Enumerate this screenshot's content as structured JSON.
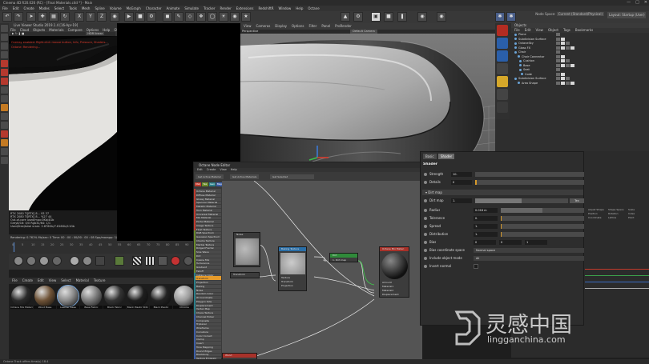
{
  "app": {
    "title": "Cinema 4D R20.026 (RC) - [Final Materials.c4d *] - Main",
    "menus": [
      "File",
      "Edit",
      "Create",
      "Modes",
      "Select",
      "Tools",
      "Mesh",
      "Spline",
      "Volume",
      "MoGraph",
      "Character",
      "Animate",
      "Simulate",
      "Tracker",
      "Render",
      "Extensions",
      "RedshiftR",
      "Window",
      "Help",
      "Octane"
    ],
    "node_space_label": "Node Space:",
    "node_space_value": "Current (Standard/Physical)",
    "layout_label": "Layout:",
    "layout_value": "Startup (User)"
  },
  "toolbar": {
    "x": "X",
    "y": "Y",
    "z": "Z"
  },
  "live_viewer": {
    "title": "Live Viewer Studio 2019.1.4 [16-Apr-19]",
    "menus": [
      "File",
      "Cloud",
      "Objects",
      "Materials",
      "Compare",
      "Options",
      "Help",
      "GUI"
    ],
    "mode": "HDR linear",
    "message1": "Overlay enabled. Right-click mouse button, Info, Pressure, Shaders...",
    "message2": "Octane: Rendering...",
    "stats": [
      "RTX 2080 Ti[RTX] 8...   93     37",
      "RTX 2080 Ti[RTX] 8...   %27    44",
      "Out-of-core used/max:0Kb/4Gb",
      "Grey8/16: 0/0          Rgb32/64: 1/1",
      "Used/free/total vram: 2.876Gb/7.616Gb/11Gb"
    ],
    "render_line": "Rendering: 0.761%  Ms/sec: 0  Time: 00 : 00 : 00/00 : 00 : 08  Spp/maxspp: 1/128  Tri: 0/664k  Mesh: 1  Hair: 0  RTX:on"
  },
  "timeline": {
    "ticks": [
      "0",
      "5",
      "10",
      "15",
      "20",
      "25",
      "30",
      "35",
      "40",
      "45",
      "50",
      "55",
      "60",
      "65",
      "70",
      "75",
      "80",
      "85",
      "90"
    ]
  },
  "materials": {
    "menus": [
      "File",
      "Create",
      "Edit",
      "View",
      "Select",
      "Material",
      "Texture"
    ],
    "items": [
      {
        "name": "Octane Mix Materi",
        "color": "#2a2a2a"
      },
      {
        "name": "Wood Base",
        "color": "#6e5236"
      },
      {
        "name": "Leather Base",
        "color": "#8a8a8a"
      },
      {
        "name": "Base Fabric",
        "color": "#7a7a7a"
      },
      {
        "name": "Black Fabric",
        "color": "#333333"
      },
      {
        "name": "Black Plastic Stitc",
        "color": "#1e1e1e"
      },
      {
        "name": "Black Plastic",
        "color": "#222222"
      },
      {
        "name": "Chrome",
        "color": "#9a9a9a"
      }
    ]
  },
  "viewport": {
    "menus": [
      "View",
      "Cameras",
      "Display",
      "Options",
      "Filter",
      "Panel",
      "ProRender"
    ],
    "projection": "Perspective",
    "camera": "Default Camera"
  },
  "objects": {
    "title": "Objects",
    "menus": [
      "File",
      "Edit",
      "View",
      "Object",
      "Tags",
      "Bookmarks"
    ],
    "items": [
      "Plane",
      "Subdivision Surface",
      "OctaneSky",
      "Glass FX",
      "Chair",
      "Chair Connector",
      "Cushion",
      "Base",
      "Seat",
      "Code",
      "Subdivision Surface",
      "Area Shape"
    ]
  },
  "node_editor": {
    "title": "Octane Node Editor",
    "menus": [
      "Edit",
      "Create",
      "View",
      "Help"
    ],
    "buttons": [
      "Get Active Material",
      "Get Active Materials",
      "Get Selected"
    ],
    "cats": [
      {
        "name": "Mat",
        "color": "#c0392b"
      },
      {
        "name": "Tex",
        "color": "#6a8a2a"
      },
      {
        "name": "Gen",
        "color": "#2a7f8a"
      },
      {
        "name": "Map",
        "color": "#3b5ea8"
      },
      {
        "name": "Map",
        "color": "#8a3a8a"
      },
      {
        "name": "Oth",
        "color": "#8a2a5a"
      },
      {
        "name": "Em",
        "color": "#c07a2a"
      },
      {
        "name": "Med",
        "color": "#666666"
      },
      {
        "name": "C4D",
        "color": "#222222"
      }
    ],
    "list": [
      "Octane Material",
      "Diffuse Material",
      "Glossy Material",
      "Specular Material",
      "Metallic Material",
      "Toon Material",
      "Universal Material",
      "Mix Material",
      "Portal Material",
      "Image Texture",
      "Float Texture",
      "RGB Spectrum",
      "Gaussian Spectrum",
      "Checks Texture",
      "Marble Texture",
      "Ridged Fractal",
      "Sine Wave",
      "Dirt",
      "Cosine Mix",
      "Turbulence",
      "Gradient",
      "Falloff",
      "Instance Color",
      "Transform",
      "Projection",
      "Baking",
      "Noise",
      "Random Color",
      "W Coordinate",
      "Polygon Side",
      "Displacement",
      "Vertex Map",
      "Chaos Texture",
      "Channel Picker",
      "Composite",
      "Triplanar",
      "Wireframe",
      "Curvature",
      "Color Correct",
      "Clamp",
      "Invert",
      "Tone Mapping",
      "Round Edges",
      "Blackbody",
      "Texture Emission"
    ],
    "list_highlight": 23,
    "nodes": {
      "noise": {
        "title": "Noise"
      },
      "baking": {
        "title": "Baking Texture",
        "ports": [
          "Texture",
          "Transform",
          "Projection"
        ]
      },
      "transform": {
        "title": "Transform"
      },
      "dirt": {
        "title": "Dirt",
        "sub": "1. Dirt map"
      },
      "mix": {
        "title": "Octane Mix Materi",
        "ports": [
          "Amount",
          "Material1",
          "Material2",
          "Displacement"
        ]
      },
      "wood": {
        "title": "Wood"
      }
    }
  },
  "shader": {
    "tabs": [
      "Basic",
      "Shader"
    ],
    "active_tab": "Shader",
    "title": "Shader",
    "strength": {
      "label": "Strength",
      "value": "10."
    },
    "details": {
      "label": "Details",
      "value": "0"
    },
    "group": "Dirt map",
    "dirt_map": {
      "label": "Dirt map",
      "value": "1.",
      "button": "Tex"
    },
    "radius": {
      "label": "Radius",
      "value": "0.016 m"
    },
    "tolerance": {
      "label": "Tolerance",
      "value": "0."
    },
    "spread": {
      "label": "Spread",
      "value": "1."
    },
    "distribution": {
      "label": "Distribution",
      "value": "1."
    },
    "bias": {
      "label": "Bias",
      "v1": "0",
      "v2": "0",
      "v3": "1"
    },
    "bias_space": {
      "label": "Bias coordinate space",
      "value": "Normal space"
    },
    "include_object": {
      "label": "Include object mode",
      "value": "All"
    },
    "invert_normal": {
      "label": "Invert normal"
    }
  },
  "rp_tabs": [
    "Adjust Shape",
    "Shape Space",
    "Scale",
    "Position",
    "Rotation",
    "Index",
    "Coordinate",
    "Lattice",
    "Point"
  ],
  "status": "Octane Track offers time(s) 18.4",
  "watermark": {
    "title": "灵感中国",
    "url": "lingganchina.com",
    "color": "#ffffff"
  }
}
